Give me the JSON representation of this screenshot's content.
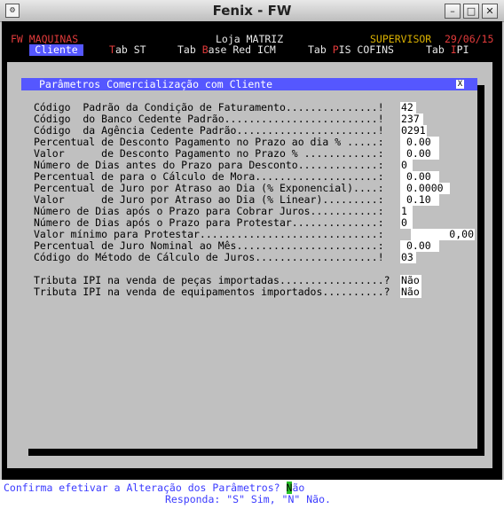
{
  "window": {
    "title": "Fenix - FW",
    "menu_icon": "app-menu-icon",
    "minimize_icon": "minimize-icon",
    "maximize_icon": "maximize-icon",
    "close_icon": "close-icon"
  },
  "header": {
    "app": "FW MAQUINAS",
    "store": "Loja MATRIZ",
    "user": "SUPERVISOR",
    "date": "29/06/15"
  },
  "tabs": [
    {
      "pre": "",
      "hotkey": "",
      "post": "Cliente",
      "selected": true
    },
    {
      "pre": "",
      "hotkey": "T",
      "post": "ab ST"
    },
    {
      "pre": "Tab ",
      "hotkey": "B",
      "post": "ase Red ICM"
    },
    {
      "pre": "Tab ",
      "hotkey": "P",
      "post": "IS COFINS"
    },
    {
      "pre": "Tab ",
      "hotkey": "I",
      "post": "PI"
    }
  ],
  "dialog": {
    "title": "Parâmetros Comercialização com Cliente",
    "close": "X"
  },
  "fields": [
    {
      "label": "Código  Padrão da Condição de Faturamento...............!",
      "value": "42"
    },
    {
      "label": "Código  do Banco Cedente Padrão.........................!",
      "value": "237"
    },
    {
      "label": "Código  da Agência Cedente Padrão.......................!",
      "value": "0291"
    },
    {
      "label": "Percentual de Desconto Pagamento no Prazo ao dia % .....:",
      "value": "0.00"
    },
    {
      "label": "Valor      de Desconto Pagamento no Prazo % ............:",
      "value": "0.00"
    },
    {
      "label": "Número de Dias antes do Prazo para Desconto.............:",
      "value": "0"
    },
    {
      "label": "Percentual de para o Cálculo de Mora....................:",
      "value": "0.00"
    },
    {
      "label": "Percentual de Juro por Atraso ao Dia (% Exponencial)....:",
      "value": "0.0000"
    },
    {
      "label": "Valor      de Juro por Atraso ao Dia (% Linear).........:",
      "value": "0.10"
    },
    {
      "label": "Número de Dias após o Prazo para Cobrar Juros...........:",
      "value": "1"
    },
    {
      "label": "Número de Dias após o Prazo para Protestar..............:",
      "value": "0"
    },
    {
      "label": "Valor mínimo para Protestar.............................:",
      "value": "0,00"
    },
    {
      "label": "Percentual de Juro Nominal ao Mês.......................:",
      "value": "0.00"
    },
    {
      "label": "Código do Método de Cálculo de Juros....................!",
      "value": "03"
    }
  ],
  "ipi": [
    {
      "label": "Tributa IPI na venda de peças importadas.................?",
      "value": "Não"
    },
    {
      "label": "Tributa IPI na venda de equipamentos importados..........?",
      "value": "Não"
    }
  ],
  "prompt": {
    "question": "Confirma efetivar a Alteração dos Parâmetros? ",
    "cursor": "N",
    "answer_rest": "ão",
    "response": "Responda: \"S\" Sim, \"N\" Não."
  }
}
